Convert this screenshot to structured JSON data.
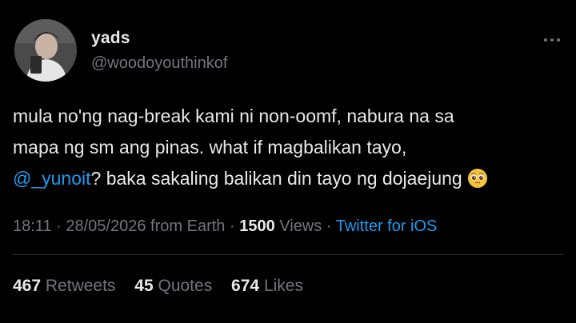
{
  "user": {
    "display_name": "yads",
    "handle": "@woodoyouthinkof",
    "avatar_icon": "profile-photo"
  },
  "tweet": {
    "line1": "mula no'ng nag-break kami ni non-oomf, nabura na sa",
    "line2": "mapa ng sm ang pinas. what if magbalikan tayo,",
    "mention": "@_yunoit",
    "line3_rest": "? baka sakaling balikan din tayo ng dojaejung",
    "emoji_icon": "pleading-face-emoji"
  },
  "meta": {
    "time": "18:11",
    "date": "28/05/2026",
    "location": "from Earth",
    "views_count": "1500",
    "views_label": "Views",
    "client": "Twitter for iOS",
    "separator": "·"
  },
  "stats": {
    "retweets_count": "467",
    "retweets_label": "Retweets",
    "quotes_count": "45",
    "quotes_label": "Quotes",
    "likes_count": "674",
    "likes_label": "Likes"
  },
  "colors": {
    "background": "#000000",
    "text": "#e7e9ea",
    "secondary": "#71767b",
    "accent": "#1d9bf0",
    "divider": "#2f3336"
  }
}
